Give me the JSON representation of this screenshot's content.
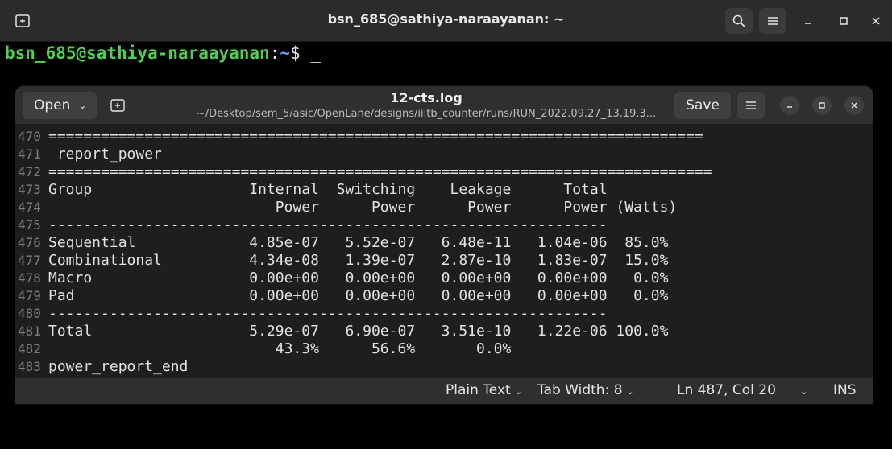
{
  "terminal": {
    "title": "bsn_685@sathiya-naraayanan: ~",
    "prompt_user": "bsn_685@sathiya-naraayanan",
    "prompt_colon": ":",
    "prompt_path": "~",
    "prompt_symbol": "$ ",
    "cursor": "_"
  },
  "gedit": {
    "open_label": "Open",
    "title": "12-cts.log",
    "subtitle": "~/Desktop/sem_5/asic/OpenLane/designs/iiitb_counter/runs/RUN_2022.09.27_13.19.3...",
    "save_label": "Save"
  },
  "editor": {
    "lines": [
      {
        "num": "470",
        "text": "==========================================================================="
      },
      {
        "num": "471",
        "text": " report_power"
      },
      {
        "num": "472",
        "text": "============================================================================"
      },
      {
        "num": "473",
        "text": "Group                  Internal  Switching    Leakage      Total"
      },
      {
        "num": "474",
        "text": "                          Power      Power      Power      Power (Watts)"
      },
      {
        "num": "475",
        "text": "----------------------------------------------------------------"
      },
      {
        "num": "476",
        "text": "Sequential             4.85e-07   5.52e-07   6.48e-11   1.04e-06  85.0%"
      },
      {
        "num": "477",
        "text": "Combinational          4.34e-08   1.39e-07   2.87e-10   1.83e-07  15.0%"
      },
      {
        "num": "478",
        "text": "Macro                  0.00e+00   0.00e+00   0.00e+00   0.00e+00   0.0%"
      },
      {
        "num": "479",
        "text": "Pad                    0.00e+00   0.00e+00   0.00e+00   0.00e+00   0.0%"
      },
      {
        "num": "480",
        "text": "----------------------------------------------------------------"
      },
      {
        "num": "481",
        "text": "Total                  5.29e-07   6.90e-07   3.51e-10   1.22e-06 100.0%"
      },
      {
        "num": "482",
        "text": "                          43.3%      56.6%       0.0%"
      },
      {
        "num": "483",
        "text": "power_report_end"
      }
    ]
  },
  "statusbar": {
    "language": "Plain Text",
    "tab_width": "Tab Width: 8",
    "position": "Ln 487, Col 20",
    "mode": "INS"
  }
}
